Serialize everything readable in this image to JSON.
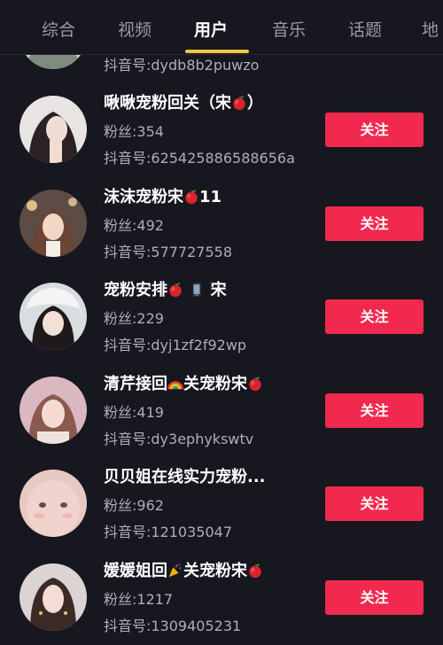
{
  "tabs": [
    {
      "label": "综合"
    },
    {
      "label": "视频"
    },
    {
      "label": "用户"
    },
    {
      "label": "音乐"
    },
    {
      "label": "话题"
    },
    {
      "label": "地"
    }
  ],
  "active_tab": "用户",
  "partial_user": {
    "douyin_id": "抖音号:dydb8b2puwzo"
  },
  "users": [
    {
      "name_prefix": "啾啾宠粉回关（宋",
      "name_suffix": "）",
      "fans": "粉丝:354",
      "douyin_id": "抖音号:625425886588656a",
      "follow_label": "关注"
    },
    {
      "name_prefix": "沫沫宠粉宋",
      "name_suffix": "11",
      "fans": "粉丝:492",
      "douyin_id": "抖音号:577727558",
      "follow_label": "关注"
    },
    {
      "name_prefix": "宠粉安排",
      "name_suffix": "宋",
      "fans": "粉丝:229",
      "douyin_id": "抖音号:dyj1zf2f92wp",
      "follow_label": "关注"
    },
    {
      "name_prefix": "清芹接回",
      "name_suffix": "关宠粉宋",
      "fans": "粉丝:419",
      "douyin_id": "抖音号:dy3ephykswtv",
      "follow_label": "关注"
    },
    {
      "name_prefix": "贝贝姐在线实力宠粉...",
      "name_suffix": "",
      "fans": "粉丝:962",
      "douyin_id": "抖音号:121035047",
      "follow_label": "关注"
    },
    {
      "name_prefix": "媛媛姐回",
      "name_suffix": "关宠粉宋",
      "fans": "粉丝:1217",
      "douyin_id": "抖音号:1309405231",
      "follow_label": "关注"
    }
  ],
  "colors": {
    "background": "#17171f",
    "follow_button": "#f1294f",
    "tab_indicator": "#f6c445"
  },
  "icons": [
    "apple-emoji-icon",
    "phone-emoji-icon",
    "rainbow-emoji-icon",
    "party-popper-emoji-icon"
  ]
}
